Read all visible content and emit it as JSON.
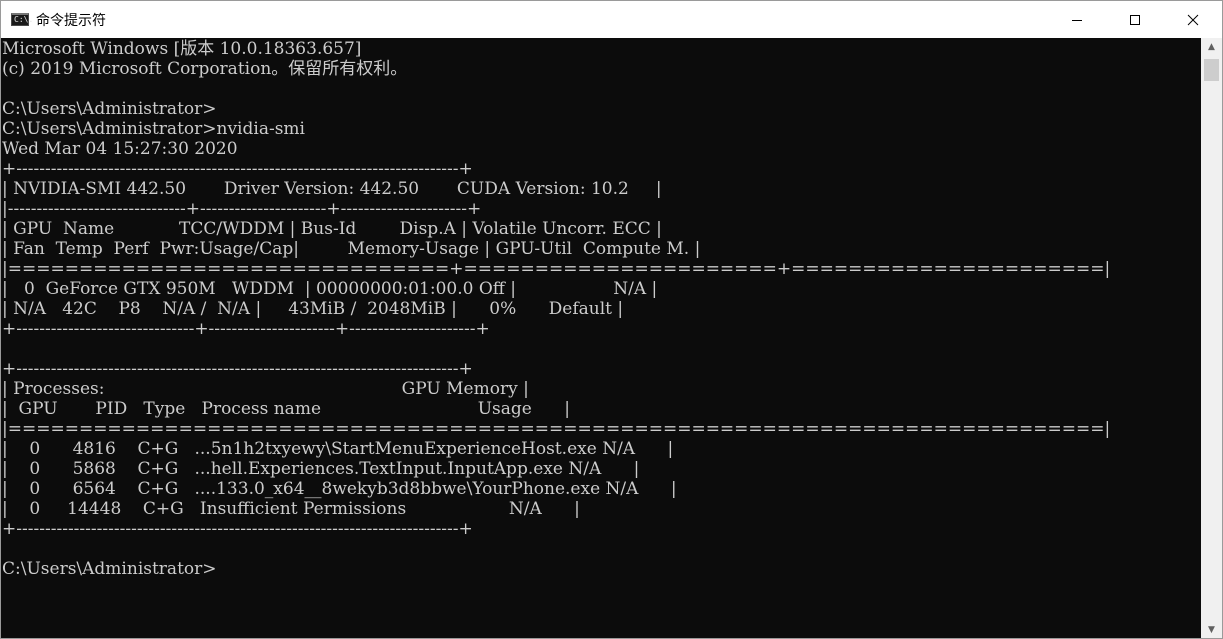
{
  "window": {
    "title": "命令提示符",
    "app_icon_text": "C:\\."
  },
  "controls": {
    "minimize": "minimize-icon",
    "maximize": "maximize-icon",
    "close": "close-icon"
  },
  "console": {
    "lines": [
      "Microsoft Windows [版本 10.0.18363.657]",
      "(c) 2019 Microsoft Corporation。保留所有权利。",
      "",
      "C:\\Users\\Administrator>",
      "C:\\Users\\Administrator>nvidia-smi",
      "Wed Mar 04 15:27:30 2020",
      "+-----------------------------------------------------------------------------+",
      "| NVIDIA-SMI 442.50       Driver Version: 442.50       CUDA Version: 10.2     |",
      "|-------------------------------+----------------------+----------------------+",
      "| GPU  Name            TCC/WDDM | Bus-Id        Disp.A | Volatile Uncorr. ECC |",
      "| Fan  Temp  Perf  Pwr:Usage/Cap|         Memory-Usage | GPU-Util  Compute M. |",
      "|===============================+======================+======================|",
      "|   0  GeForce GTX 950M   WDDM  | 00000000:01:00.0 Off |                  N/A |",
      "| N/A   42C    P8    N/A /  N/A |     43MiB /  2048MiB |      0%      Default |",
      "+-------------------------------+----------------------+----------------------+",
      "",
      "+-----------------------------------------------------------------------------+",
      "| Processes:                                                       GPU Memory |",
      "|  GPU       PID   Type   Process name                             Usage      |",
      "|=============================================================================|",
      "|    0      4816    C+G   ...5n1h2txyewy\\StartMenuExperienceHost.exe N/A      |",
      "|    0      5868    C+G   ...hell.Experiences.TextInput.InputApp.exe N/A      |",
      "|    0      6564    C+G   ....133.0_x64__8wekyb3d8bbwe\\YourPhone.exe N/A      |",
      "|    0     14448    C+G   Insufficient Permissions                   N/A      |",
      "+-----------------------------------------------------------------------------+",
      "",
      "C:\\Users\\Administrator>"
    ]
  },
  "colors": {
    "console_bg": "#0c0c0c",
    "console_fg": "#cccccc",
    "titlebar_bg": "#ffffff"
  }
}
